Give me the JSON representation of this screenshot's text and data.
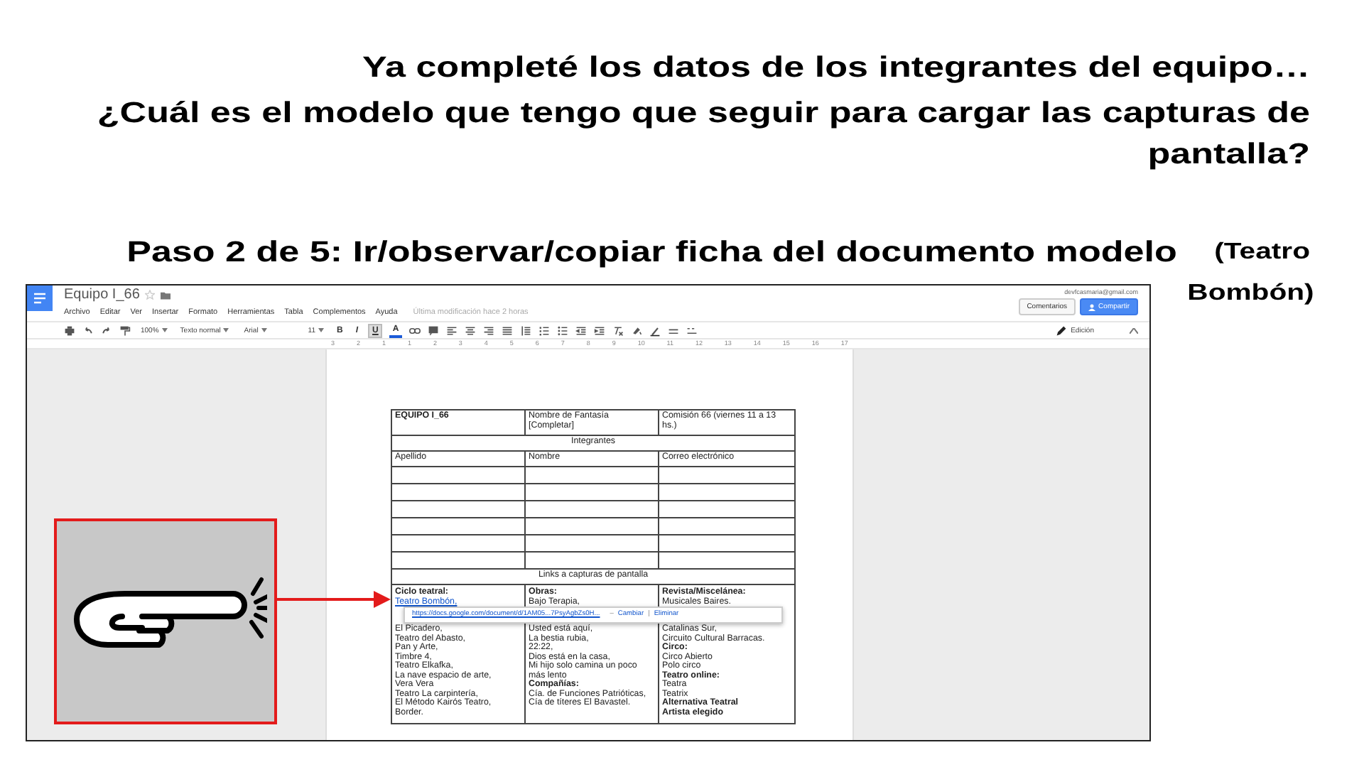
{
  "slide": {
    "heading": "Ya completé los datos de los integrantes del equipo…",
    "question": "¿Cuál es el modelo que tengo que seguir para cargar las capturas de pantalla?",
    "step": {
      "text": "Paso 2 de 5: Ir/observar/copiar ficha del documento modelo",
      "note": "(Teatro Bombón)"
    }
  },
  "document_window": {
    "title": "Equipo I_66",
    "starred": false,
    "menu": [
      "Archivo",
      "Editar",
      "Ver",
      "Insertar",
      "Formato",
      "Herramientas",
      "Tabla",
      "Complementos",
      "Ayuda"
    ],
    "last_edit": "Última modificación hace 2 horas",
    "account": "devfcasmaria@gmail.com",
    "buttons": [
      {
        "label": "Comentarios",
        "kind": "plain"
      },
      {
        "label": "Compartir",
        "kind": "primary"
      }
    ],
    "toolbar": {
      "zoom": "100%",
      "style": "Texto normal",
      "font": "Arial",
      "size": "11",
      "format": [
        {
          "label": "B",
          "kind": "bold",
          "selected": false
        },
        {
          "label": "I",
          "kind": "italic",
          "selected": false
        },
        {
          "label": "U",
          "kind": "underline",
          "selected": true
        },
        {
          "label": "A",
          "kind": "color",
          "selected": false
        }
      ],
      "mode": "Edición"
    },
    "ruler": [
      "3",
      "2",
      "1",
      "1",
      "2",
      "3",
      "4",
      "5",
      "6",
      "7",
      "8",
      "9",
      "10",
      "11",
      "12",
      "13",
      "14",
      "15",
      "16",
      "17"
    ],
    "table": {
      "header": [
        "EQUIPO I_66",
        "Nombre de Fantasía [Completar]",
        "Comisión 66 (viernes 11 a 13 hs.)"
      ],
      "section": "Integrantes",
      "columns": [
        "Apellido",
        "Nombre",
        "Correo electrónico"
      ],
      "links_title": "Links a capturas de pantalla",
      "link_cells": [
        {
          "above": [
            {
              "text": "Ciclo teatral:",
              "kind": "heading"
            },
            {
              "text": "Teatro Bombón,",
              "kind": "link"
            }
          ],
          "below": [
            {
              "text": "El Picadero,",
              "kind": "plain"
            },
            {
              "text": "Teatro del Abasto,",
              "kind": "plain"
            },
            {
              "text": "Pan y Arte,",
              "kind": "plain"
            },
            {
              "text": "Timbre 4,",
              "kind": "plain"
            },
            {
              "text": "Teatro Elkafka,",
              "kind": "plain"
            },
            {
              "text": "La nave espacio de arte,",
              "kind": "plain"
            },
            {
              "text": "Vera Vera",
              "kind": "plain"
            },
            {
              "text": "Teatro La carpintería,",
              "kind": "plain"
            },
            {
              "text": "El Método Kairós Teatro,",
              "kind": "plain"
            },
            {
              "text": "Border.",
              "kind": "plain"
            }
          ]
        },
        {
          "above": [
            {
              "text": "Obras:",
              "kind": "heading"
            },
            {
              "text": "Bajo Terapia,",
              "kind": "plain"
            }
          ],
          "below": [
            {
              "text": "Usted está aquí,",
              "kind": "plain"
            },
            {
              "text": "La bestia rubia,",
              "kind": "plain"
            },
            {
              "text": "22:22,",
              "kind": "plain"
            },
            {
              "text": "Dios está en la casa,",
              "kind": "plain"
            },
            {
              "text": "Mi hijo solo camina un poco más lento",
              "kind": "plain"
            },
            {
              "text": "Compañías:",
              "kind": "heading"
            },
            {
              "text": "Cía. de Funciones Patrióticas,",
              "kind": "plain"
            },
            {
              "text": "Cía de títeres El Bavastel.",
              "kind": "plain"
            }
          ]
        },
        {
          "above": [
            {
              "text": "Revista/Miscelánea:",
              "kind": "heading"
            },
            {
              "text": "Musicales Baires.",
              "kind": "plain"
            }
          ],
          "below": [
            {
              "text": "Catalinas Sur,",
              "kind": "plain"
            },
            {
              "text": "Circuito Cultural Barracas.",
              "kind": "plain"
            },
            {
              "text": "Circo:",
              "kind": "heading"
            },
            {
              "text": "Circo Abierto",
              "kind": "plain"
            },
            {
              "text": "Polo circo",
              "kind": "plain"
            },
            {
              "text": "Teatro online:",
              "kind": "heading"
            },
            {
              "text": "Teatra",
              "kind": "plain"
            },
            {
              "text": "Teatrix",
              "kind": "plain"
            },
            {
              "text": "Alternativa Teatral",
              "kind": "heading"
            },
            {
              "text": "Artista elegido",
              "kind": "heading"
            }
          ]
        }
      ],
      "link_popup": {
        "url": "https://docs.google.com/document/d/1AM05...7PsyAgbZs0H...",
        "prefix": "–",
        "actions": [
          "Cambiar",
          "Eliminar"
        ],
        "separator": "|"
      }
    }
  }
}
